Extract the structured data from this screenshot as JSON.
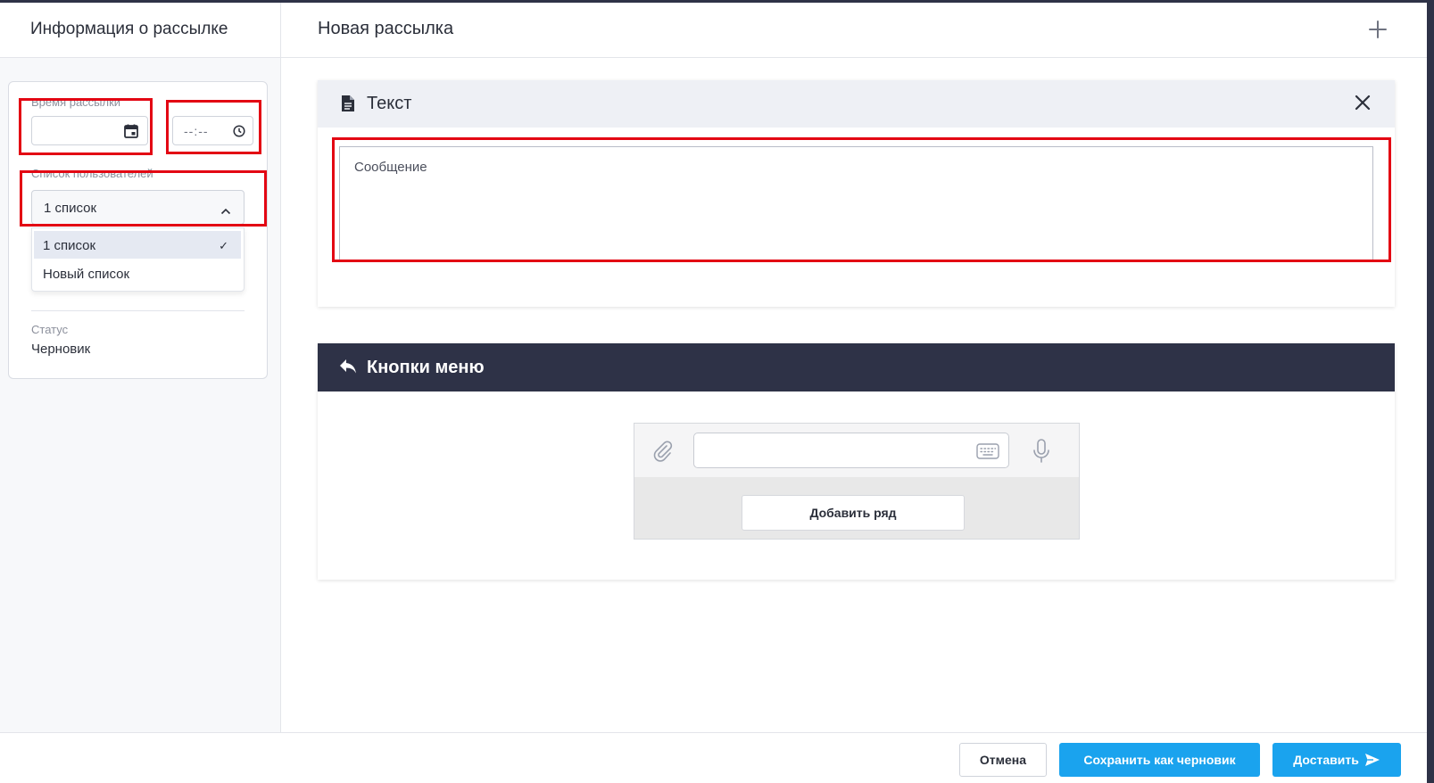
{
  "header": {
    "left_title": "Информация о рассылке",
    "main_title": "Новая рассылка",
    "plus_icon": "plus-icon"
  },
  "sidebar": {
    "schedule_label": "Время рассылки",
    "date_value": "",
    "time_placeholder": "--:--",
    "user_list_label": "Список пользователей",
    "selected_list": "1 список",
    "dropdown_options": [
      "1 список",
      "Новый список"
    ],
    "status_label": "Статус",
    "status_value": "Черновик"
  },
  "text_block": {
    "title": "Текст",
    "message_placeholder": "Сообщение"
  },
  "menu_block": {
    "title": "Кнопки меню",
    "add_row_label": "Добавить ряд"
  },
  "footer": {
    "cancel_label": "Отмена",
    "draft_label": "Сохранить как черновик",
    "send_label": "Доставить"
  },
  "colors": {
    "accent": "#1aa3ee",
    "dark": "#2e3247",
    "highlight": "#e30613"
  }
}
